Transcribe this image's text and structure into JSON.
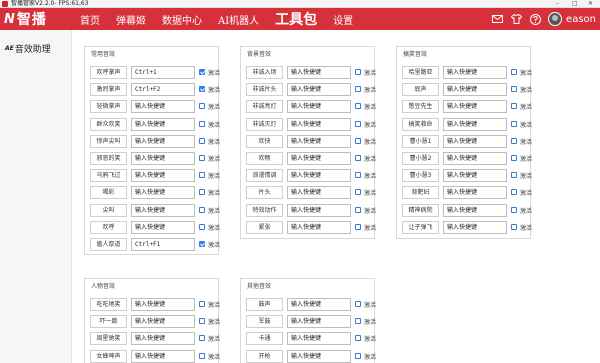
{
  "window": {
    "title": "智播管家V2.2.0- FPS:61,63",
    "minimize": "–",
    "maximize": "□",
    "close": "✕"
  },
  "header": {
    "logo_mark": "N",
    "logo_text": "智播",
    "nav": [
      {
        "label": "首页",
        "active": false
      },
      {
        "label": "弹幕姬",
        "active": false
      },
      {
        "label": "数据中心",
        "active": false
      },
      {
        "label": "AI机器人",
        "active": false
      },
      {
        "label": "工具包",
        "active": true
      },
      {
        "label": "设置",
        "active": false
      }
    ],
    "icons": [
      "mail-icon",
      "shirt-icon",
      "help-icon"
    ],
    "user_name": "eason"
  },
  "sidebar": {
    "icon_text": "AE",
    "item_label": "音效助理"
  },
  "colors": {
    "brand": "#d6313a",
    "checkbox": "#2f7fe6"
  },
  "panels": [
    {
      "key": "common",
      "title": "常用音效",
      "rows": [
        {
          "label": "欢呼掌声",
          "value": "Ctrl+1",
          "checked": true,
          "check_label": "激活"
        },
        {
          "label": "激烈掌声",
          "value": "Ctrl+F2",
          "checked": true,
          "check_label": "激活"
        },
        {
          "label": "轻微掌声",
          "value": "输入快捷键",
          "checked": false,
          "check_label": "激活"
        },
        {
          "label": "群众欢笑",
          "value": "输入快捷键",
          "checked": false,
          "check_label": "激活"
        },
        {
          "label": "惊声尖叫",
          "value": "输入快捷键",
          "checked": false,
          "check_label": "激活"
        },
        {
          "label": "邪恶的笑",
          "value": "输入快捷键",
          "checked": false,
          "check_label": "激活"
        },
        {
          "label": "乌鸦飞过",
          "value": "输入快捷键",
          "checked": false,
          "check_label": "激活"
        },
        {
          "label": "喝彩",
          "value": "输入快捷键",
          "checked": false,
          "check_label": "激活"
        },
        {
          "label": "尖叫",
          "value": "输入快捷键",
          "checked": false,
          "check_label": "激活"
        },
        {
          "label": "欢呼",
          "value": "输入快捷键",
          "checked": false,
          "check_label": "激活"
        },
        {
          "label": "尴人厚道",
          "value": "Ctrl+F1",
          "checked": true,
          "check_label": "激活"
        }
      ]
    },
    {
      "key": "background",
      "title": "背景音效",
      "rows": [
        {
          "label": "非诚入场",
          "value": "输入快捷键",
          "checked": false,
          "check_label": "激活"
        },
        {
          "label": "非诚片头",
          "value": "输入快捷键",
          "checked": false,
          "check_label": "激活"
        },
        {
          "label": "非诚亮灯",
          "value": "输入快捷键",
          "checked": false,
          "check_label": "激活"
        },
        {
          "label": "非诚灭灯",
          "value": "输入快捷键",
          "checked": false,
          "check_label": "激活"
        },
        {
          "label": "欢快",
          "value": "输入快捷键",
          "checked": false,
          "check_label": "激活"
        },
        {
          "label": "欢畅",
          "value": "输入快捷键",
          "checked": false,
          "check_label": "激活"
        },
        {
          "label": "浪漫情调",
          "value": "输入快捷键",
          "checked": false,
          "check_label": "激活"
        },
        {
          "label": "片头",
          "value": "输入快捷键",
          "checked": false,
          "check_label": "激活"
        },
        {
          "label": "特效动作",
          "value": "输入快捷键",
          "checked": false,
          "check_label": "激活"
        },
        {
          "label": "紧张",
          "value": "输入快捷键",
          "checked": false,
          "check_label": "激活"
        }
      ]
    },
    {
      "key": "funny",
      "title": "搞笑音效",
      "rows": [
        {
          "label": "哈里路亚",
          "value": "输入快捷键",
          "checked": false,
          "check_label": "激活"
        },
        {
          "label": "屁声",
          "value": "输入快捷键",
          "checked": false,
          "check_label": "激活"
        },
        {
          "label": "憋豆先生",
          "value": "输入快捷键",
          "checked": false,
          "check_label": "激活"
        },
        {
          "label": "搞笑救命",
          "value": "输入快捷键",
          "checked": false,
          "check_label": "激活"
        },
        {
          "label": "曹小慧1",
          "value": "输入快捷键",
          "checked": false,
          "check_label": "激活"
        },
        {
          "label": "曹小慧2",
          "value": "输入快捷键",
          "checked": false,
          "check_label": "激活"
        },
        {
          "label": "曹小慧3",
          "value": "输入快捷键",
          "checked": false,
          "check_label": "激活"
        },
        {
          "label": "背靶妇",
          "value": "输入快捷键",
          "checked": false,
          "check_label": "激活"
        },
        {
          "label": "精神病院",
          "value": "输入快捷键",
          "checked": false,
          "check_label": "激活"
        },
        {
          "label": "让子弹飞",
          "value": "输入快捷键",
          "checked": false,
          "check_label": "激活"
        }
      ]
    },
    {
      "key": "character",
      "title": "人物音效",
      "rows": [
        {
          "label": "吃吃地笑",
          "value": "输入快捷键",
          "checked": false,
          "check_label": "激活"
        },
        {
          "label": "吓一跳",
          "value": "输入快捷键",
          "checked": false,
          "check_label": "激活"
        },
        {
          "label": "周星驰笑",
          "value": "输入快捷键",
          "checked": false,
          "check_label": "激活"
        },
        {
          "label": "女蜂呻声",
          "value": "输入快捷键",
          "checked": false,
          "check_label": "激活"
        }
      ]
    },
    {
      "key": "other",
      "title": "其他音效",
      "rows": [
        {
          "label": "鼓声",
          "value": "输入快捷键",
          "checked": false,
          "check_label": "激活"
        },
        {
          "label": "军鼓",
          "value": "输入快捷键",
          "checked": false,
          "check_label": "激活"
        },
        {
          "label": "卡通",
          "value": "输入快捷键",
          "checked": false,
          "check_label": "激活"
        },
        {
          "label": "开枪",
          "value": "输入快捷键",
          "checked": false,
          "check_label": "激活"
        }
      ]
    }
  ]
}
